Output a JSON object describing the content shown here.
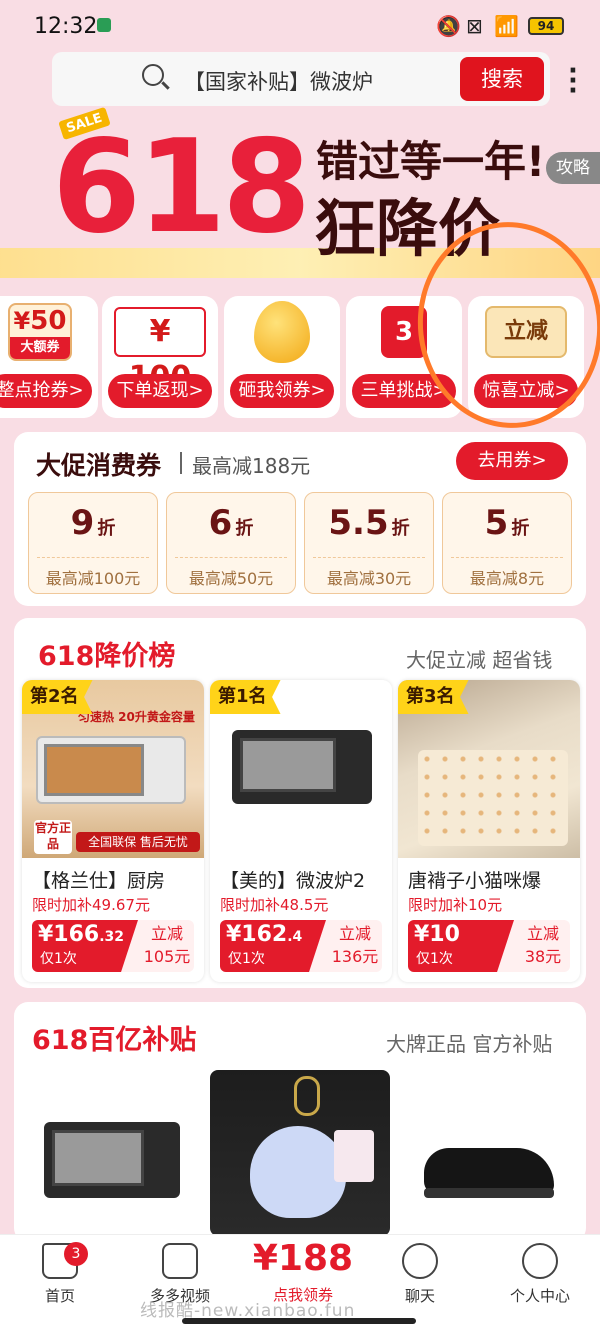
{
  "status": {
    "time": "12:32",
    "battery": "94"
  },
  "search": {
    "query": "【国家补贴】微波炉",
    "button": "搜索"
  },
  "banner": {
    "sale": "SALE",
    "number": "618",
    "line1": "错过等一年!",
    "line2": "狂降价",
    "guide": "攻略"
  },
  "features": [
    {
      "top": "50",
      "top_sub": "大额券",
      "label": "整点抢券>"
    },
    {
      "top": "100",
      "label": "下单返现>"
    },
    {
      "label": "砸我领券>"
    },
    {
      "top": "3",
      "label": "三单挑战>"
    },
    {
      "top": "立减",
      "label": "惊喜立减>"
    }
  ],
  "coupons": {
    "title": "大促消费券",
    "subtitle": "最高减188元",
    "button": "去用券>",
    "items": [
      {
        "value": "9",
        "unit": "折",
        "desc": "最高减100元"
      },
      {
        "value": "6",
        "unit": "折",
        "desc": "最高减50元"
      },
      {
        "value": "5.5",
        "unit": "折",
        "desc": "最高减30元"
      },
      {
        "value": "5",
        "unit": "折",
        "desc": "最高减8元"
      }
    ]
  },
  "ranking": {
    "title": "618降价榜",
    "subtitle": "大促立减 超省钱",
    "items": [
      {
        "badge": "第2名",
        "name": "【格兰仕】厨房",
        "sub": "限时加补49.67元",
        "price": "¥166",
        "price_dec": ".32",
        "once": "仅1次",
        "save1": "立减",
        "save2": "105元",
        "ad1": "匀速热 20升黄金容量",
        "ad2": "官方正品",
        "ad3": "全国联保 售后无忧"
      },
      {
        "badge": "第1名",
        "name": "【美的】微波炉2",
        "sub": "限时加补48.5元",
        "price": "¥162",
        "price_dec": ".4",
        "once": "仅1次",
        "save1": "立减",
        "save2": "136元"
      },
      {
        "badge": "第3名",
        "name": "唐褙子小猫咪爆",
        "sub": "限时加补10元",
        "price": "¥10",
        "price_dec": "",
        "once": "仅1次",
        "save1": "立减",
        "save2": "38元"
      }
    ]
  },
  "subsidy": {
    "title": "618百亿补贴",
    "subtitle": "大牌正品 官方补贴"
  },
  "nav": {
    "home": "首页",
    "home_badge": "3",
    "video": "多多视频",
    "center_value": "¥188",
    "center_label": "点我领券",
    "chat": "聊天",
    "me": "个人中心"
  },
  "watermark": "线报酷-new.xianbao.fun",
  "colors": {
    "accent": "#e31b2b",
    "page_bg": "#f9dde4",
    "gold": "#ffd319"
  }
}
